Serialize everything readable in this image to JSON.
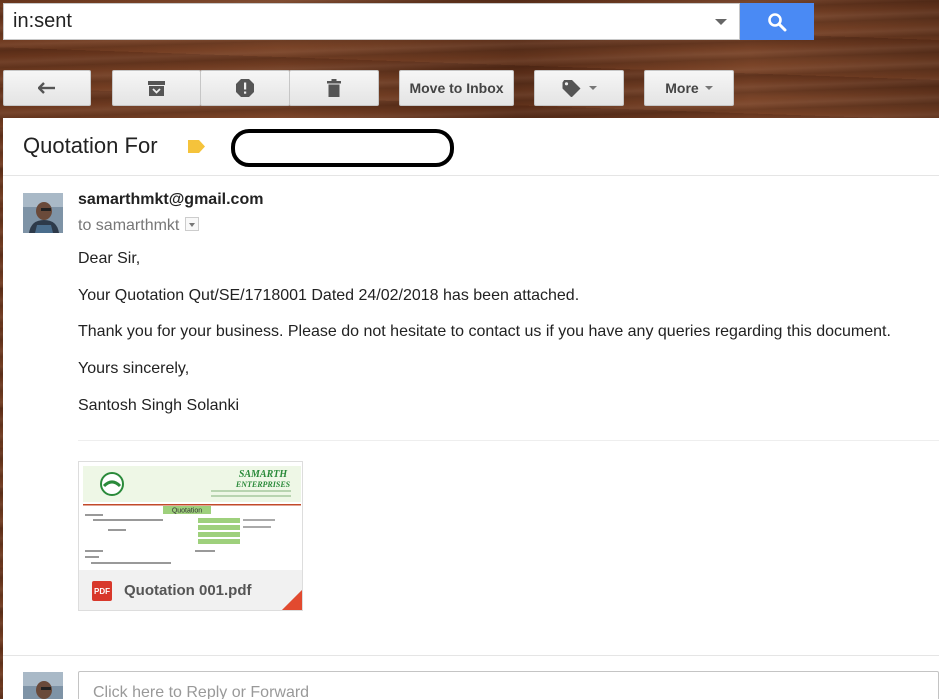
{
  "search": {
    "query": "in:sent"
  },
  "toolbar": {
    "move_to_inbox": "Move to Inbox",
    "more": "More"
  },
  "message": {
    "subject": "Quotation For",
    "sender": "samarthmkt@gmail.com",
    "to": "to samarthmkt",
    "body": [
      "Dear Sir,",
      "Your Quotation Qut/SE/1718001 Dated 24/02/2018 has been attached.",
      "Thank you for your business. Please do not hesitate to contact us if you have any queries regarding this document.",
      "Yours sincerely,",
      "Santosh Singh Solanki"
    ]
  },
  "attachment": {
    "filename": "Quotation 001.pdf",
    "type_label": "PDF",
    "preview": {
      "company_line1": "SAMARTH",
      "company_line2": "ENTERPRISES",
      "doc_title": "Quotation"
    }
  },
  "reply": {
    "placeholder": "Click here to Reply or Forward"
  },
  "colors": {
    "search_button": "#4a8af4",
    "label_tag": "#f5c33b",
    "pdf_red": "#d8382b"
  },
  "icons": [
    "search-icon",
    "reply-icon",
    "archive-icon",
    "spam-icon",
    "trash-icon",
    "label-icon",
    "pdf-icon"
  ]
}
